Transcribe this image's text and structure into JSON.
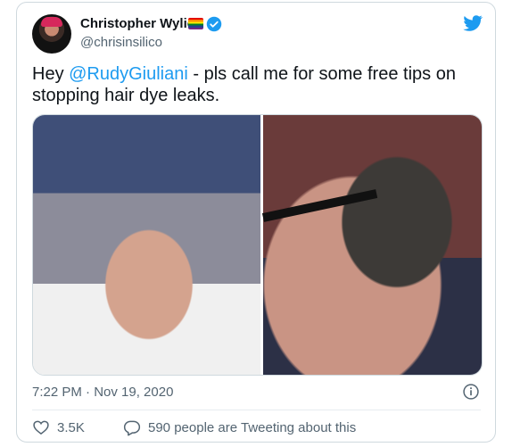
{
  "author": {
    "name": "Christopher Wylie",
    "handle": "@chrisinsilico",
    "verified": true,
    "badge_icon": "rainbow-flag-icon"
  },
  "tweet": {
    "prefix": "Hey ",
    "mention": "@RudyGiuliani",
    "suffix": " - pls call me for some free tips on stopping hair dye leaks."
  },
  "media": {
    "left_image": "man with hair dye running down face",
    "right_image": "close-up side profile with dye running"
  },
  "meta": {
    "timestamp": "7:22 PM · Nov 19, 2020"
  },
  "footer": {
    "likes": "3.5K",
    "replies_text": "590 people are Tweeting about this"
  },
  "colors": {
    "accent": "#1d9bf0",
    "secondary_text": "#536471",
    "border": "#cfd9de"
  },
  "icons": {
    "logo": "twitter-bird-icon",
    "info": "info-icon",
    "like": "heart-icon",
    "reply": "chat-bubble-icon"
  }
}
